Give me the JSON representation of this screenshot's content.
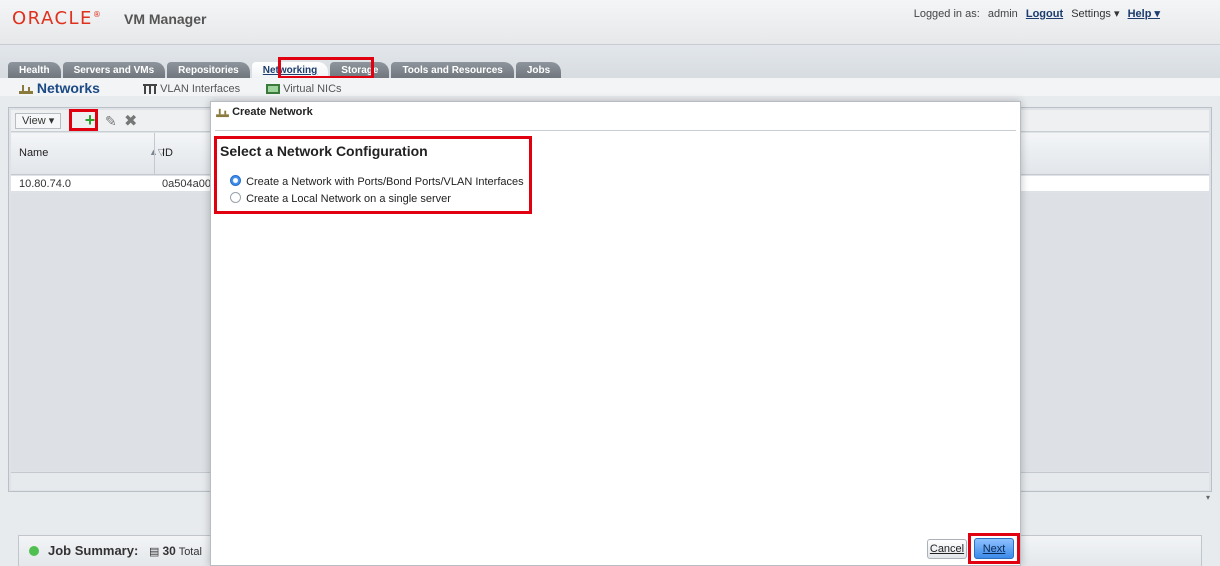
{
  "header": {
    "logo_text": "ORACLE",
    "app_title": "VM Manager",
    "logged_in_label": "Logged in as:",
    "user": "admin",
    "logout": "Logout",
    "settings": "Settings ▾",
    "help": "Help ▾"
  },
  "tabs": [
    {
      "label": "Health"
    },
    {
      "label": "Servers and VMs"
    },
    {
      "label": "Repositories"
    },
    {
      "label": "Networking"
    },
    {
      "label": "Storage"
    },
    {
      "label": "Tools and Resources"
    },
    {
      "label": "Jobs"
    }
  ],
  "subnav": {
    "networks": "Networks",
    "vlan": "VLAN Interfaces",
    "vnics": "Virtual NICs"
  },
  "toolbar": {
    "view": "View ▾"
  },
  "grid": {
    "columns": [
      "Name",
      "ID"
    ],
    "rows": [
      {
        "name": "10.80.74.0",
        "id": "0a504a00"
      }
    ]
  },
  "jobs": {
    "label": "Job Summary:",
    "total_count": "30",
    "total_label": "Total"
  },
  "dialog": {
    "title": "Create Network",
    "section_title": "Select a Network Configuration",
    "options": [
      {
        "label": "Create a Network with Ports/Bond Ports/VLAN Interfaces",
        "selected": true
      },
      {
        "label": "Create a Local Network on a single server",
        "selected": false
      }
    ],
    "cancel": "Cancel",
    "next": "Next"
  },
  "colors": {
    "highlight": "#e00010",
    "brand": "#e0301e",
    "accent": "#3b8bea"
  }
}
